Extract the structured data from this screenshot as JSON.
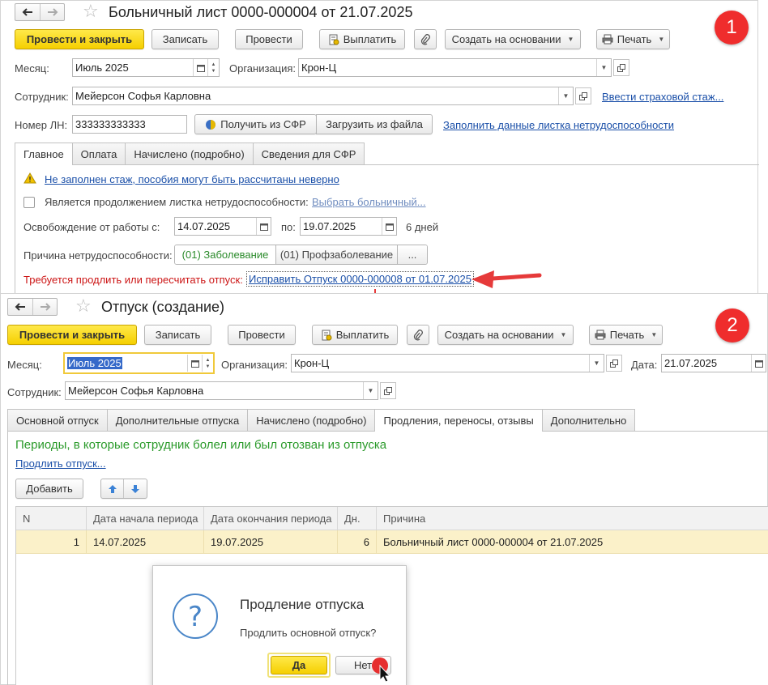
{
  "window1": {
    "title": "Больничный лист 0000-000004 от 21.07.2025",
    "toolbar": {
      "post_close": "Провести и закрыть",
      "save": "Записать",
      "post": "Провести",
      "pay": "Выплатить",
      "create_based": "Создать на основании",
      "print": "Печать"
    },
    "month_label": "Месяц:",
    "month_value": "Июль 2025",
    "org_label": "Организация:",
    "org_value": "Крон-Ц",
    "employee_label": "Сотрудник:",
    "employee_value": "Мейерсон Софья Карловна",
    "insurance_link": "Ввести страховой стаж...",
    "ln_label": "Номер ЛН:",
    "ln_value": "333333333333",
    "get_sfr": "Получить из СФР",
    "load_file": "Загрузить из файла",
    "fill_link": "Заполнить данные листка нетрудоспособности",
    "tabs": [
      "Главное",
      "Оплата",
      "Начислено (подробно)",
      "Сведения для СФР"
    ],
    "warning": "Не заполнен стаж, пособия могут быть рассчитаны неверно",
    "continuation_label": "Является продолжением листка нетрудоспособности:",
    "choose_link": "Выбрать больничный...",
    "release_label": "Освобождение от работы с:",
    "date_from": "14.07.2025",
    "to_label": "по:",
    "date_to": "19.07.2025",
    "days": "6 дней",
    "reason_label": "Причина нетрудоспособности:",
    "reason_options": [
      "(01) Заболевание",
      "(01) Профзаболевание",
      "..."
    ],
    "extend_msg": "Требуется продлить или пересчитать отпуск:",
    "fix_link": "Исправить Отпуск 0000-000008 от 01.07.2025"
  },
  "window2": {
    "title": "Отпуск (создание)",
    "toolbar": {
      "post_close": "Провести и закрыть",
      "save": "Записать",
      "post": "Провести",
      "pay": "Выплатить",
      "create_based": "Создать на основании",
      "print": "Печать"
    },
    "month_label": "Месяц:",
    "month_value": "Июль 2025",
    "org_label": "Организация:",
    "org_value": "Крон-Ц",
    "date_label": "Дата:",
    "date_value": "21.07.2025",
    "employee_label": "Сотрудник:",
    "employee_value": "Мейерсон Софья Карловна",
    "tabs": [
      "Основной отпуск",
      "Дополнительные отпуска",
      "Начислено (подробно)",
      "Продления, переносы, отзывы",
      "Дополнительно"
    ],
    "section_title": "Периоды, в которые сотрудник болел или был отозван из отпуска",
    "extend_link": "Продлить отпуск...",
    "add_button": "Добавить",
    "table": {
      "headers": [
        "N",
        "Дата начала периода",
        "Дата окончания периода",
        "Дн.",
        "Причина"
      ],
      "rows": [
        [
          "1",
          "14.07.2025",
          "19.07.2025",
          "6",
          "Больничный лист 0000-000004 от 21.07.2025"
        ]
      ]
    }
  },
  "dialog": {
    "title": "Продление отпуска",
    "question": "Продлить основной отпуск?",
    "yes": "Да",
    "no": "Нет"
  },
  "badges": [
    "1",
    "2"
  ],
  "colors": {
    "primary_button": "#f5cf00",
    "link": "#1a4fa8",
    "error_text": "#cc1414",
    "section_title": "#2a9a2a",
    "badge": "#ef2d2d",
    "selected_row": "#fbf1c9"
  }
}
